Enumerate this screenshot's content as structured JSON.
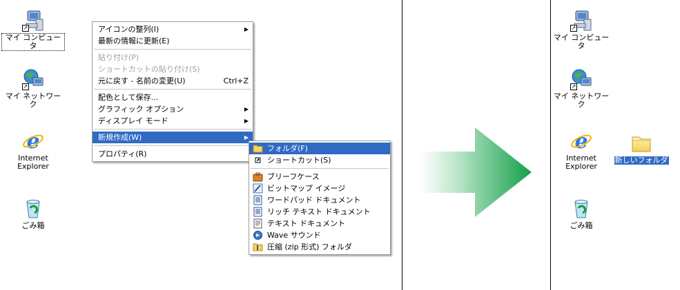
{
  "desktop_icons": [
    {
      "label": "マイ コンピュータ"
    },
    {
      "label": "マイ ネットワーク"
    },
    {
      "label": "Internet Explorer"
    },
    {
      "label": "ごみ箱"
    }
  ],
  "context_menu": {
    "items": [
      {
        "label": "アイコンの整列(I)"
      },
      {
        "label": "最新の情報に更新(E)"
      },
      {
        "label": "貼り付け(P)"
      },
      {
        "label": "ショートカットの貼り付け(S)"
      },
      {
        "label": "元に戻す - 名前の変更(U)",
        "shortcut": "Ctrl+Z"
      },
      {
        "label": "配色として保存..."
      },
      {
        "label": "グラフィック オプション"
      },
      {
        "label": "ディスプレイ モード"
      },
      {
        "label": "新規作成(W)"
      },
      {
        "label": "プロパティ(R)"
      }
    ]
  },
  "submenu": {
    "items": [
      {
        "label": "フォルダ(F)",
        "icon": "folder-icon"
      },
      {
        "label": "ショートカット(S)",
        "icon": "shortcut-icon"
      },
      {
        "label": "ブリーフケース",
        "icon": "briefcase-icon"
      },
      {
        "label": "ビットマップ イメージ",
        "icon": "bitmap-icon"
      },
      {
        "label": "ワードパッド ドキュメント",
        "icon": "wordpad-icon"
      },
      {
        "label": "リッチ テキスト ドキュメント",
        "icon": "rtf-icon"
      },
      {
        "label": "テキスト ドキュメント",
        "icon": "text-doc-icon"
      },
      {
        "label": "Wave サウンド",
        "icon": "wave-icon"
      },
      {
        "label": "圧縮 (zip 形式) フォルダ",
        "icon": "zip-folder-icon"
      }
    ]
  },
  "new_folder": {
    "label": "新しいフォルダ"
  },
  "colors": {
    "highlight": "#316ac5",
    "arrow_start": "#e6f5ec",
    "arrow_end": "#1aa64a"
  }
}
